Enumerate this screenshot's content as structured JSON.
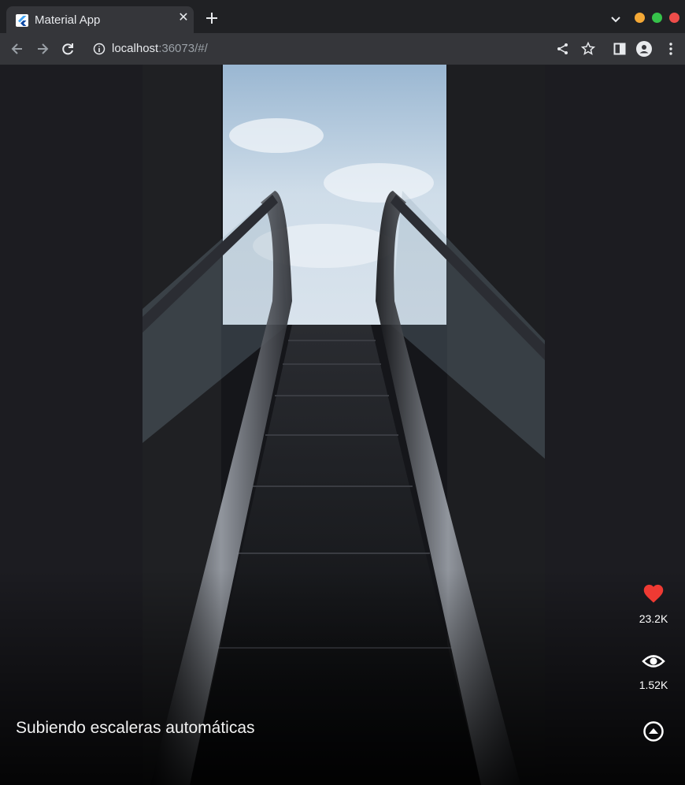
{
  "browser": {
    "tab": {
      "title": "Material App"
    },
    "address": {
      "host": "localhost",
      "rest": ":36073/#/"
    }
  },
  "post": {
    "caption": "Subiendo escaleras automáticas",
    "likes": "23.2K",
    "views": "1.52K"
  },
  "colors": {
    "like": "#ef3a33",
    "background": "#1c1c21"
  },
  "icons": [
    "heart-icon",
    "eye-icon",
    "expand-up-icon"
  ]
}
